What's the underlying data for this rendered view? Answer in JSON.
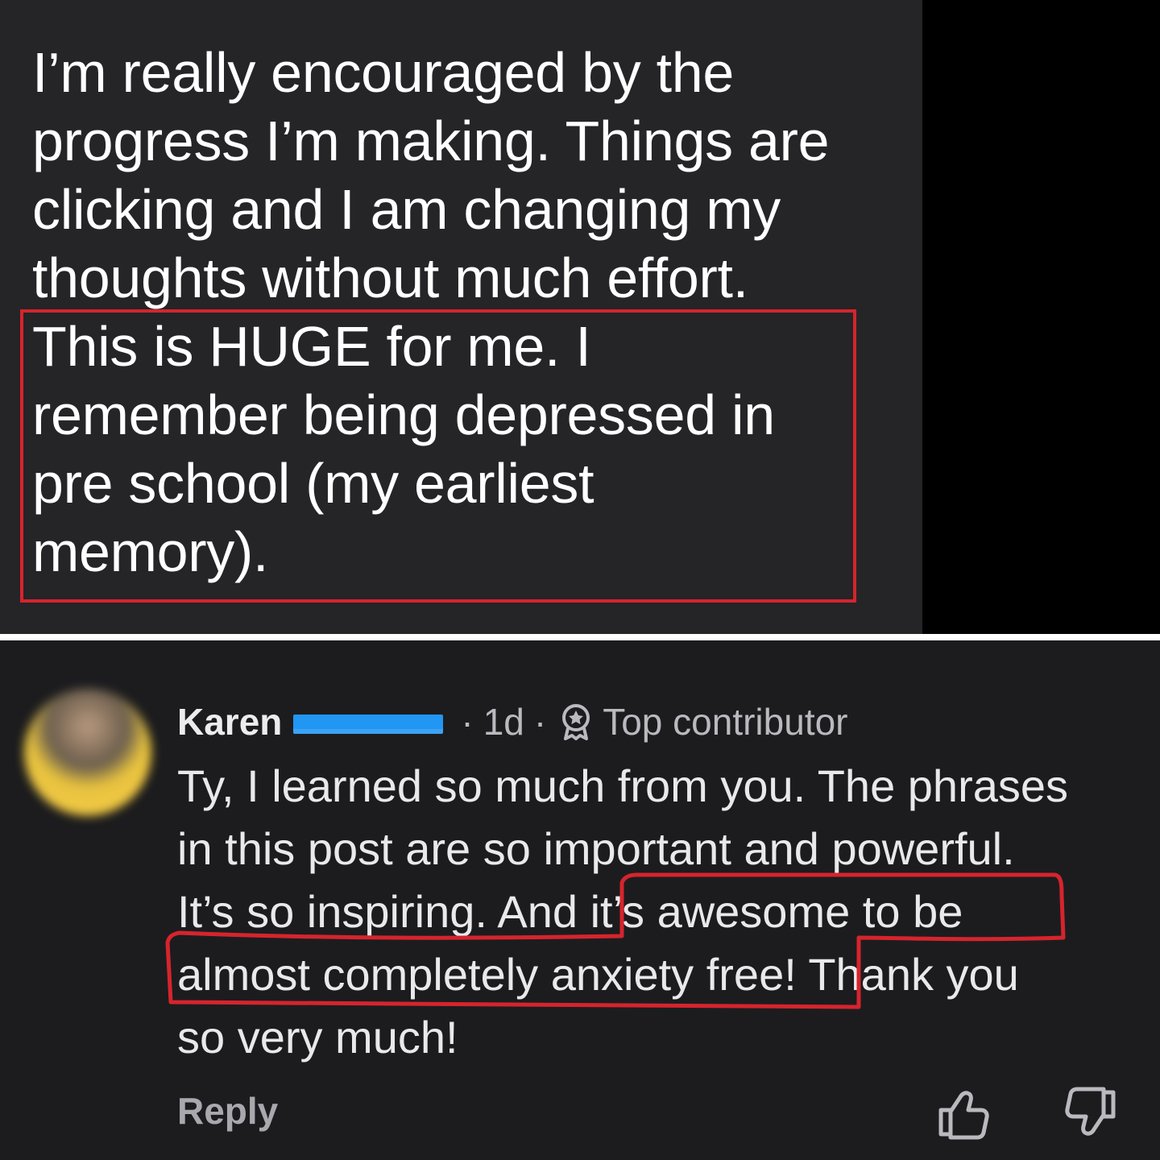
{
  "post": {
    "lines": [
      "I’m really encouraged by the",
      "progress I’m making. Things are",
      "clicking and I am changing my",
      "thoughts without much effort.",
      "This is HUGE for me. I",
      "remember being depressed in",
      "pre school (my earliest",
      "memory)."
    ]
  },
  "comment": {
    "author": "Karen",
    "separator": "·",
    "time": "1d",
    "badge_icon": "award-ribbon-icon",
    "badge_label": "Top contributor",
    "lines": [
      "Ty, I learned so much from you. The phrases",
      "in this post are so important and powerful.",
      "It’s so inspiring. And it’s awesome to be",
      "almost completely anxiety free! Thank you",
      "so very much!"
    ],
    "reply_label": "Reply",
    "like_icon": "thumbs-up-icon",
    "dislike_icon": "thumbs-down-icon"
  },
  "colors": {
    "top_panel_bg": "#252427",
    "comment_bg": "#1c1c1e",
    "annotation_red": "#d6242d",
    "redaction_blue": "#2196f3"
  }
}
